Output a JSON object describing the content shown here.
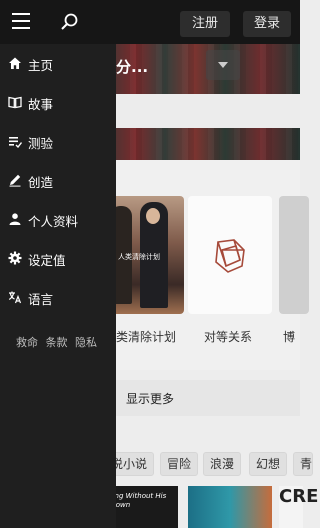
{
  "header": {
    "register_label": "注册",
    "login_label": "登录"
  },
  "drawer": {
    "items": [
      {
        "label": "主页",
        "icon": "home-icon"
      },
      {
        "label": "故事",
        "icon": "book-icon"
      },
      {
        "label": "测验",
        "icon": "quiz-list-icon"
      },
      {
        "label": "创造",
        "icon": "pencil-icon"
      },
      {
        "label": "个人资料",
        "icon": "profile-icon"
      },
      {
        "label": "设定值",
        "icon": "gear-icon"
      },
      {
        "label": "语言",
        "icon": "translate-icon"
      }
    ],
    "footer_links": [
      "救命",
      "条款",
      "隐私"
    ]
  },
  "background": {
    "hero_title": "分...",
    "cards": [
      {
        "label": "类清除计划",
        "cover_text": "人类清除计划"
      },
      {
        "label": "对等关系"
      },
      {
        "label": "博"
      }
    ],
    "show_more": "显示更多",
    "tags": [
      "说小说",
      "冒险",
      "浪漫",
      "幻想",
      "青"
    ],
    "bottom_cover_text": "King Without His Crown",
    "bottom_cover_text_2": "CRE"
  }
}
